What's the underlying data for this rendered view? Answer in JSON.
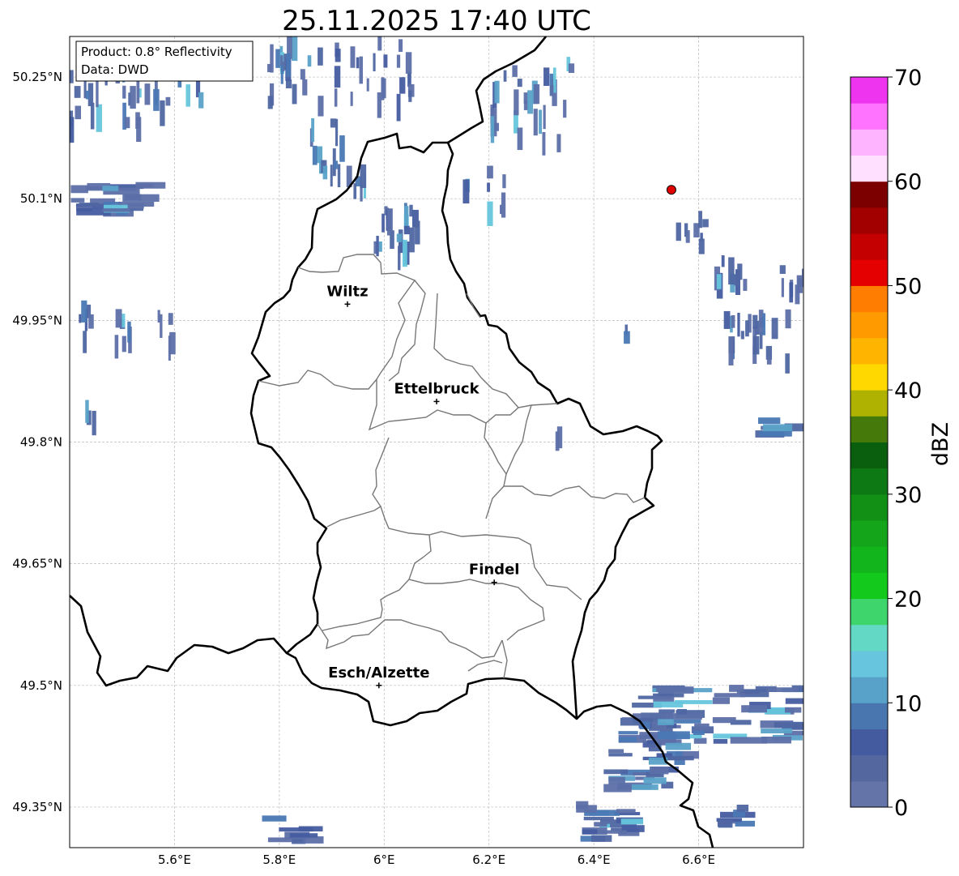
{
  "title": "25.11.2025 17:40 UTC",
  "info_box": {
    "product": "Product: 0.8° Reflectivity",
    "data": "Data: DWD"
  },
  "map_extent": {
    "lon_min": 5.4,
    "lon_max": 6.8,
    "lat_min": 49.3,
    "lat_max": 50.3
  },
  "lat_ticks": [
    {
      "value": 50.25,
      "label": "50.25°N"
    },
    {
      "value": 50.1,
      "label": "50.1°N"
    },
    {
      "value": 49.95,
      "label": "49.95°N"
    },
    {
      "value": 49.8,
      "label": "49.8°N"
    },
    {
      "value": 49.65,
      "label": "49.65°N"
    },
    {
      "value": 49.5,
      "label": "49.5°N"
    },
    {
      "value": 49.35,
      "label": "49.35°N"
    }
  ],
  "lon_ticks": [
    {
      "value": 5.6,
      "label": "5.6°E"
    },
    {
      "value": 5.8,
      "label": "5.8°E"
    },
    {
      "value": 6.0,
      "label": "6°E"
    },
    {
      "value": 6.2,
      "label": "6.2°E"
    },
    {
      "value": 6.4,
      "label": "6.4°E"
    },
    {
      "value": 6.6,
      "label": "6.6°E"
    }
  ],
  "cities": [
    {
      "name": "Wiltz",
      "lon": 5.93,
      "lat": 49.97
    },
    {
      "name": "Ettelbruck",
      "lon": 6.1,
      "lat": 49.85
    },
    {
      "name": "Findel",
      "lon": 6.21,
      "lat": 49.627
    },
    {
      "name": "Esch/Alzette",
      "lon": 5.99,
      "lat": 49.5
    }
  ],
  "radar_site": {
    "lon": 6.548,
    "lat": 50.111,
    "color": "#e00000"
  },
  "colorbar": {
    "label": "dBZ",
    "min": 0,
    "max": 70,
    "ticks": [
      "0",
      "10",
      "20",
      "30",
      "40",
      "50",
      "60",
      "70"
    ],
    "colors": [
      "#6473a8",
      "#55679f",
      "#445c9f",
      "#4a76b0",
      "#58a1c9",
      "#67c5de",
      "#63d8c4",
      "#3ed66c",
      "#13c91c",
      "#12b51c",
      "#14a51a",
      "#128f15",
      "#0d7914",
      "#0a5f0e",
      "#457a0b",
      "#afb200",
      "#ffd800",
      "#ffb500",
      "#ff9a00",
      "#ff7d00",
      "#e40000",
      "#c50000",
      "#a20000",
      "#7c0000",
      "#ffe1ff",
      "#ffb4ff",
      "#ff73ff",
      "#ee34ee"
    ]
  }
}
